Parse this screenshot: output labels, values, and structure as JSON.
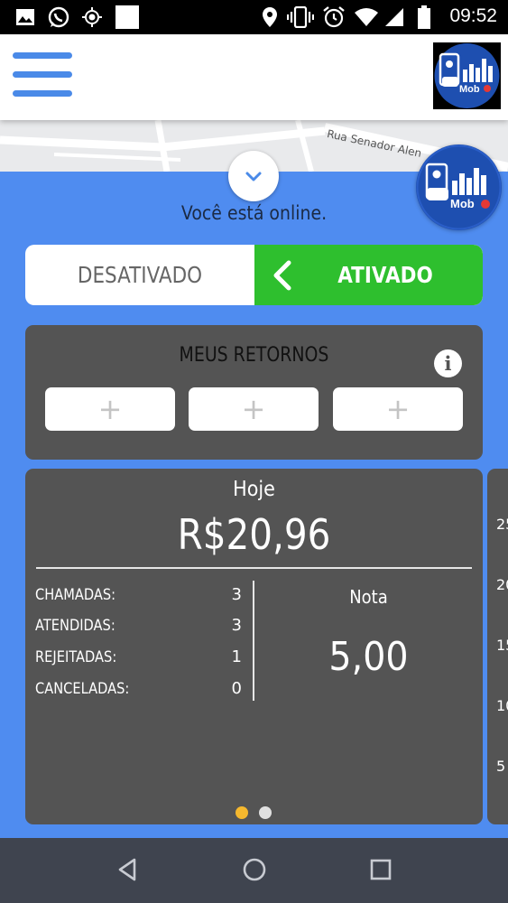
{
  "status_bar": {
    "time": "09:52",
    "icons": [
      "image-icon",
      "whatsapp-icon",
      "location-target-icon",
      "blank-notification-icon",
      "location-pin-icon",
      "vibrate-icon",
      "alarm-icon",
      "wifi-icon",
      "signal-icon",
      "battery-icon"
    ]
  },
  "header": {
    "menu_icon": "hamburger-menu-icon",
    "logo_text": "Mob"
  },
  "map": {
    "street_label": "Rua Senador Alen"
  },
  "panel": {
    "online_status": "Você está online.",
    "switch": {
      "off_label": "DESATIVADO",
      "on_label": "ATIVADO",
      "active": "on"
    }
  },
  "retornos": {
    "title": "MEUS RETORNOS",
    "info_icon": "i",
    "slots": [
      "+",
      "+",
      "+"
    ]
  },
  "summary": {
    "period": "Hoje",
    "amount": "R$20,96",
    "stats": [
      {
        "label": "CHAMADAS:",
        "value": "3"
      },
      {
        "label": "ATENDIDAS:",
        "value": "3"
      },
      {
        "label": "REJEITADAS:",
        "value": "1"
      },
      {
        "label": "CANCELADAS:",
        "value": "0"
      }
    ],
    "rating_label": "Nota",
    "rating_value": "5,00",
    "pager": {
      "count": 2,
      "active_index": 0
    },
    "next_card_ticks": [
      "25",
      "20",
      "15",
      "10",
      "5"
    ]
  },
  "colors": {
    "panel_blue": "#4f8cf0",
    "active_green": "#2ebf2e",
    "card_gray": "#545454",
    "pager_active": "#f5b82e",
    "pager_inactive": "#e0e0e0"
  },
  "navbar": {
    "buttons": [
      "back-icon",
      "home-icon",
      "recents-icon"
    ]
  }
}
